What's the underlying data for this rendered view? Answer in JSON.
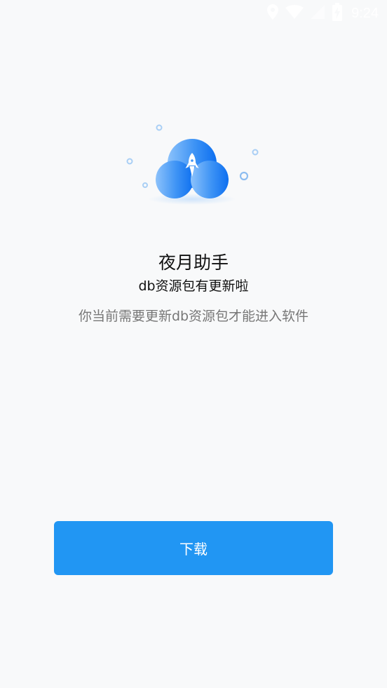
{
  "status_bar": {
    "time": "9:24",
    "icons": [
      "location-icon",
      "wifi-icon",
      "signal-icon",
      "battery-charging-icon"
    ]
  },
  "dialog": {
    "title": "夜月助手",
    "subtitle": "db资源包有更新啦",
    "description": "你当前需要更新db资源包才能进入软件",
    "illustration_icon": "cloud-rocket-icon"
  },
  "actions": {
    "download_label": "下载"
  },
  "colors": {
    "background": "#f8f9fa",
    "accent": "#2196f3",
    "title_text": "#111111",
    "secondary_text": "#777777",
    "status_icon": "#ffffff"
  }
}
